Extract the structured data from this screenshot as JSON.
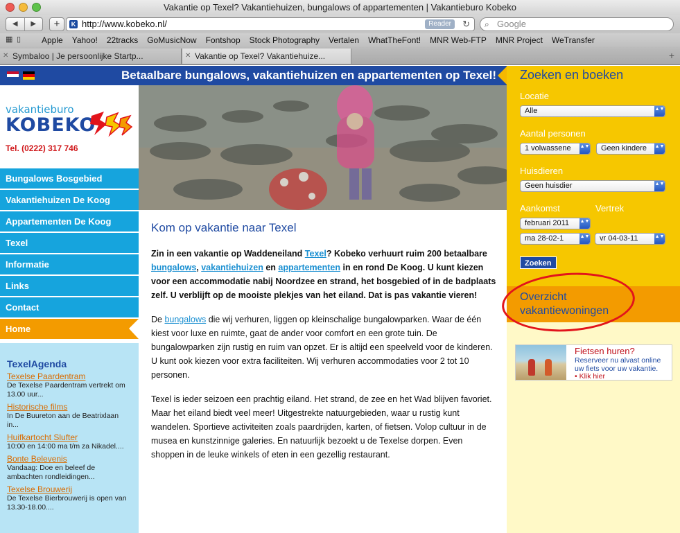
{
  "window": {
    "title": "Vakantie op Texel? Vakantiehuizen, bungalows of appartementen | Vakantieburo Kobeko"
  },
  "toolbar": {
    "back_glyph": "◀",
    "forward_glyph": "▶",
    "add_glyph": "+",
    "url": "http://www.kobeko.nl/",
    "reader_label": "Reader",
    "reload_glyph": "↻",
    "search_placeholder": "Google"
  },
  "bookmarks": {
    "grid_glyph": "▦",
    "book_glyph": "▯",
    "items": [
      "Apple",
      "Yahoo!",
      "22tracks",
      "GoMusicNow",
      "Fontshop",
      "Stock Photography",
      "Vertalen",
      "WhatTheFont!",
      "MNR Web-FTP",
      "MNR Project",
      "WeTransfer"
    ]
  },
  "tabs": [
    {
      "label": "Symbaloo | Je persoonlijke Startp...",
      "close": "✕"
    },
    {
      "label": "Vakantie op Texel? Vakantiehuize...",
      "close": "✕"
    }
  ],
  "newtab_glyph": "+",
  "banner": {
    "headline": "Betaalbare bungalows, vakantiehuizen en appartementen op Texel!"
  },
  "logo": {
    "small": "vakantieburo",
    "big": "KOBEKO",
    "phone": "Tel. (0222) 317 746"
  },
  "nav": [
    "Bungalows Bosgebied",
    "Vakantiehuizen De Koog",
    "Appartementen De Koog",
    "Texel",
    "Informatie",
    "Links",
    "Contact",
    "Home"
  ],
  "agenda": {
    "title": "TexelAgenda",
    "items": [
      {
        "title": "Texelse Paardentram",
        "desc": "De Texelse Paardentram vertrekt om 13.00 uur..."
      },
      {
        "title": "Historische films",
        "desc": "In De Buureton aan de Beatrixlaan in..."
      },
      {
        "title": "Huifkartocht Slufter",
        "desc": "10:00 en 14:00 ma t/m za Nikadel...."
      },
      {
        "title": "Bonte Belevenis",
        "desc": "Vandaag: Doe en beleef de ambachten rondleidingen..."
      },
      {
        "title": "Texelse Brouwerij",
        "desc": "De Texelse Bierbrouwerij is open van 13.30-18.00...."
      }
    ]
  },
  "content": {
    "heading": "Kom op vakantie naar Texel",
    "intro": {
      "t1": "Zin in een vakantie op Waddeneiland ",
      "l1": "Texel",
      "t2": "? Kobeko verhuurt ruim 200 betaalbare ",
      "l2": "bungalows",
      "t3": ", ",
      "l3": "vakantiehuizen",
      "t4": " en ",
      "l4": "appartementen",
      "t5": " in en rond De Koog. U kunt kiezen voor een accommodatie nabij Noordzee en strand, het bosgebied of in de badplaats zelf. U verblijft op de mooiste plekjes van het eiland. Dat is pas vakantie vieren!"
    },
    "p2": {
      "t1": "De ",
      "l1": "bungalows",
      "t2": " die wij verhuren, liggen op kleinschalige bungalowparken. Waar de één kiest voor luxe en ruimte, gaat de ander voor comfort en een grote tuin. De bungalowparken zijn rustig en ruim van opzet. Er is altijd een speelveld voor de kinderen. U kunt ook kiezen voor extra faciliteiten. Wij verhuren accommodaties voor 2 tot 10 personen."
    },
    "p3": "Texel is ieder seizoen een prachtig eiland. Het strand, de zee en het Wad blijven favoriet. Maar het eiland biedt veel meer! Uitgestrekte natuurgebieden, waar u rustig kunt wandelen. Sportieve activiteiten zoals paardrijden, karten, of fietsen. Volop cultuur in de musea en kunstzinnige galeries. En natuurlijk bezoekt u de Texelse dorpen. Even shoppen in de leuke winkels of eten in een gezellig restaurant."
  },
  "search": {
    "title": "Zoeken en boeken",
    "locatie_label": "Locatie",
    "locatie_value": "Alle",
    "personen_label": "Aantal personen",
    "volwassene_value": "1 volwassene",
    "kinderen_value": "Geen kindere",
    "huisdieren_label": "Huisdieren",
    "huisdieren_value": "Geen huisdier",
    "aankomst_label": "Aankomst",
    "vertrek_label": "Vertrek",
    "month_value": "februari 2011",
    "aankomst_value": "ma 28-02-1",
    "vertrek_value": "vr 04-03-11",
    "button": "Zoeken",
    "caret_glyph": "▲▼"
  },
  "overzicht": {
    "line1": "Overzicht",
    "line2": "vakantiewoningen"
  },
  "fietsen": {
    "title": "Fietsen huren?",
    "desc": "Reserveer nu alvast online uw fiets voor uw vakantie.",
    "link": "• Klik hier"
  },
  "colors": {
    "brand_blue": "#1f4aa2",
    "nav_cyan": "#16a4dd",
    "accent_orange": "#f39b00",
    "search_yellow": "#f6c700",
    "circle_red": "#e2141b"
  }
}
